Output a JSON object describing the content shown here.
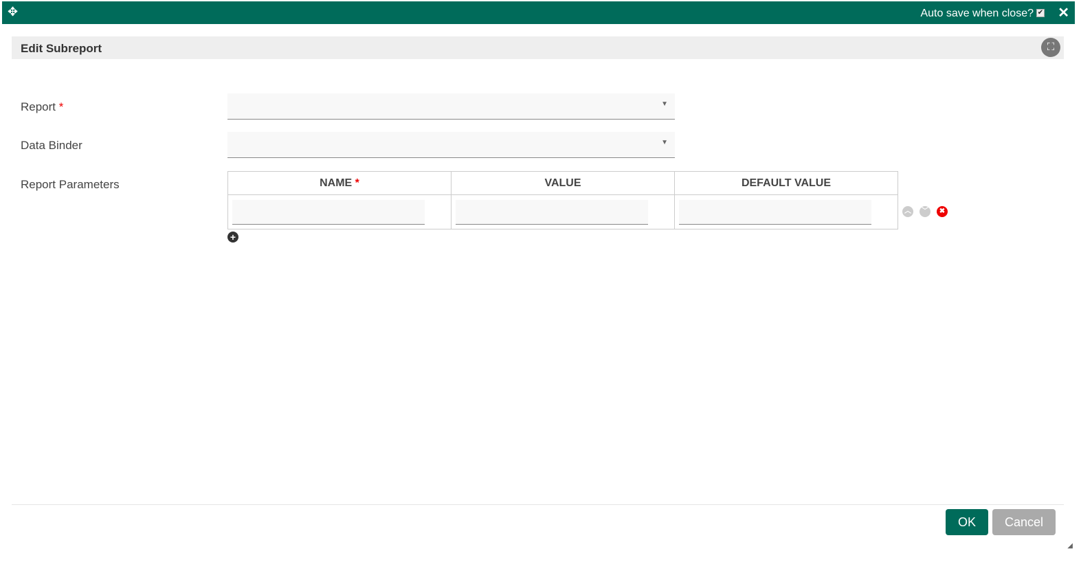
{
  "titlebar": {
    "autosave_label": "Auto save when close?",
    "autosave_checked": true
  },
  "dialog": {
    "title": "Edit Subreport"
  },
  "form": {
    "report_label": "Report",
    "report_value": "",
    "binder_label": "Data Binder",
    "binder_value": "",
    "params_label": "Report Parameters",
    "columns": [
      "NAME",
      "VALUE",
      "DEFAULT VALUE"
    ],
    "rows": [
      {
        "name": "",
        "value": "",
        "default": ""
      }
    ]
  },
  "buttons": {
    "ok": "OK",
    "cancel": "Cancel"
  },
  "colors": {
    "brand": "#006b5a",
    "cancel": "#aaaaaa",
    "delete": "#e00000"
  }
}
